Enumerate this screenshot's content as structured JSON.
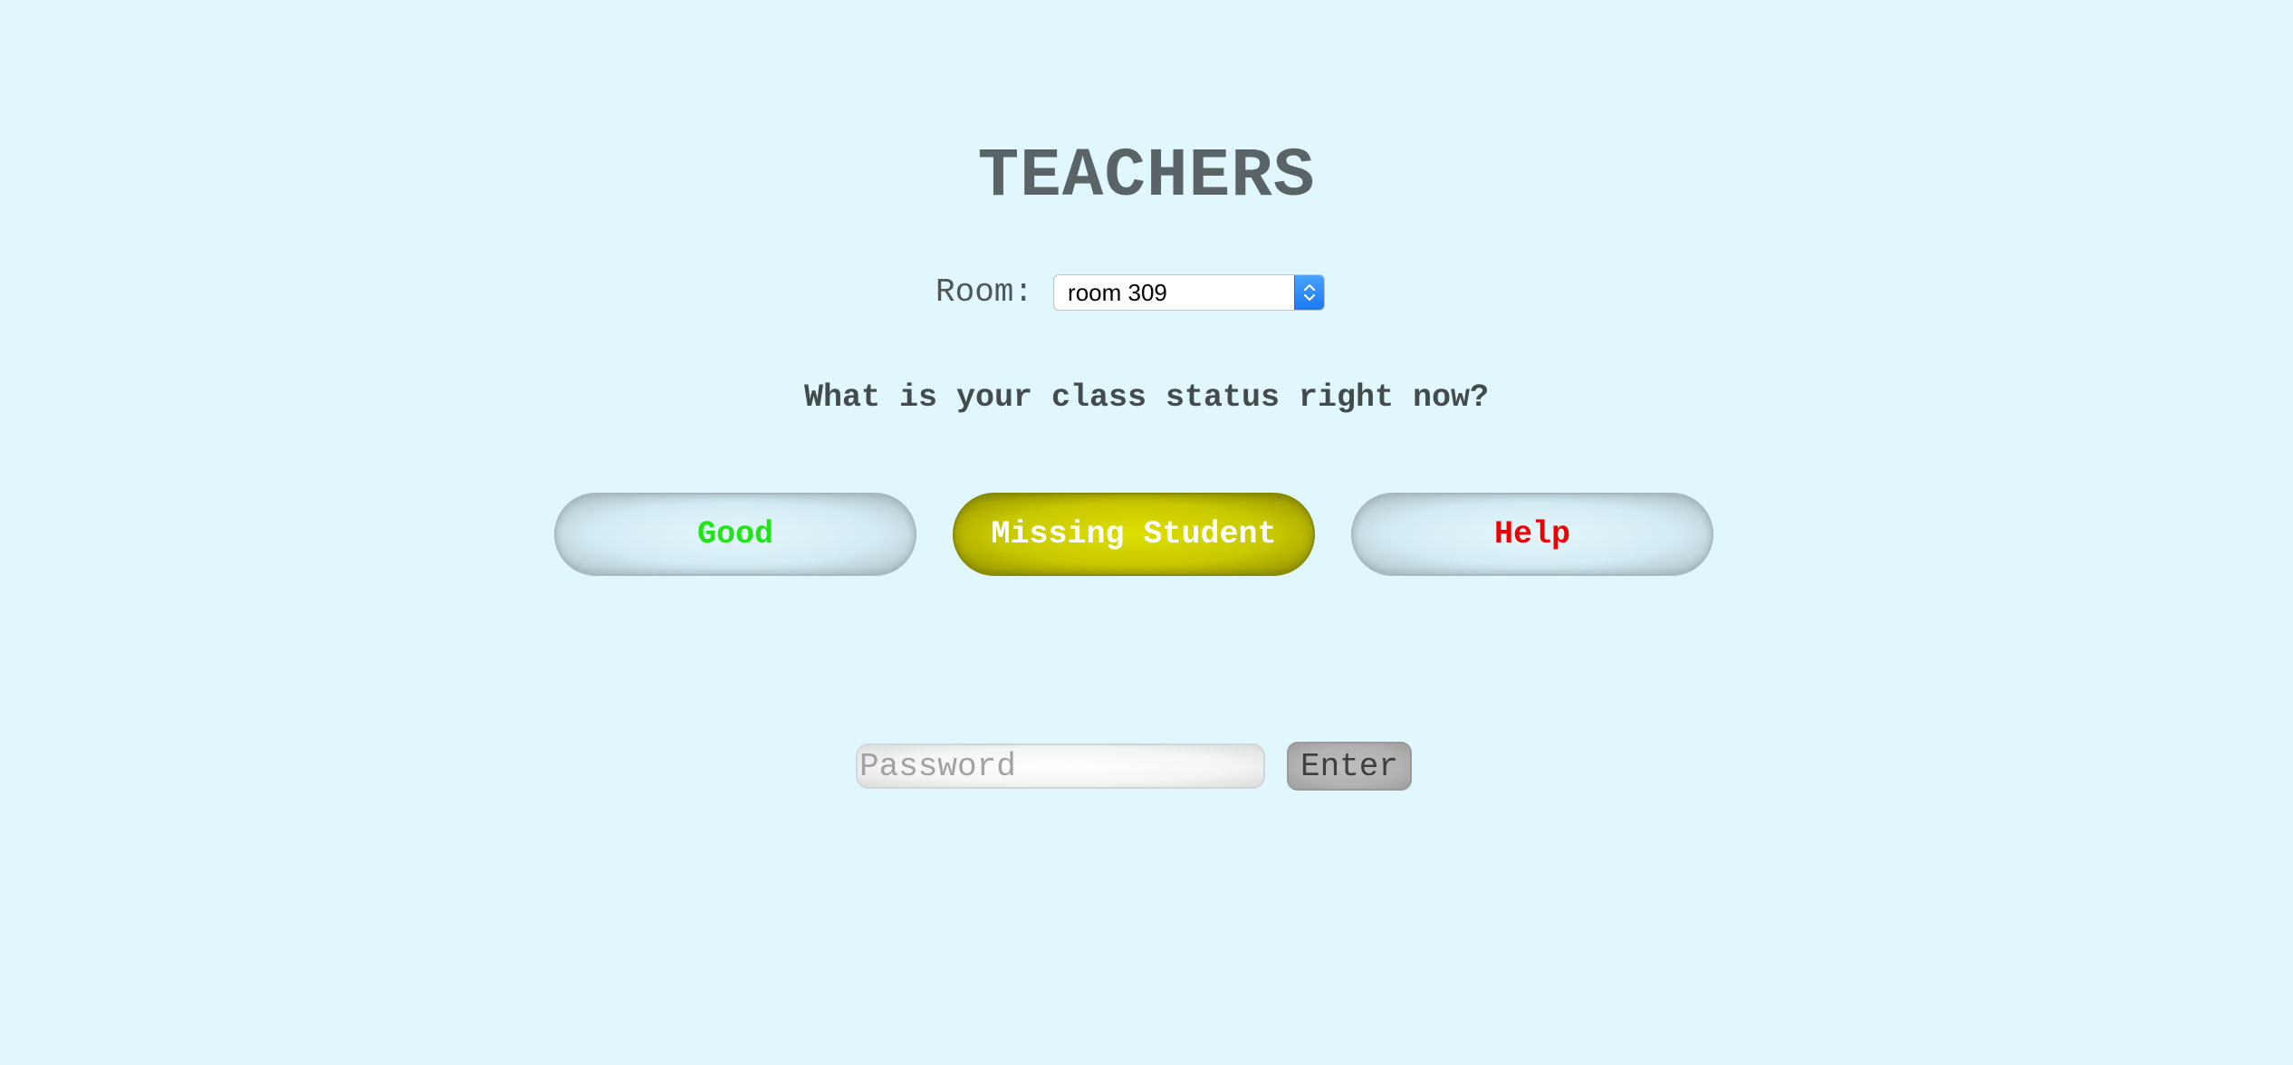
{
  "page": {
    "title": "TEACHERS",
    "background_color": "#e0f8fd"
  },
  "room": {
    "label": "Room:",
    "selected": "room 309",
    "arrow_icon": "chevron-up-down-icon"
  },
  "status": {
    "question": "What is your class status right now?",
    "buttons": [
      {
        "label": "Good",
        "color": "#1ee616"
      },
      {
        "label": "Missing Student",
        "color": "#ffffff",
        "fill": "#c8c800"
      },
      {
        "label": "Help",
        "color": "#ee0000"
      }
    ]
  },
  "auth": {
    "password_placeholder": "Password",
    "password_value": "",
    "enter_label": "Enter"
  }
}
